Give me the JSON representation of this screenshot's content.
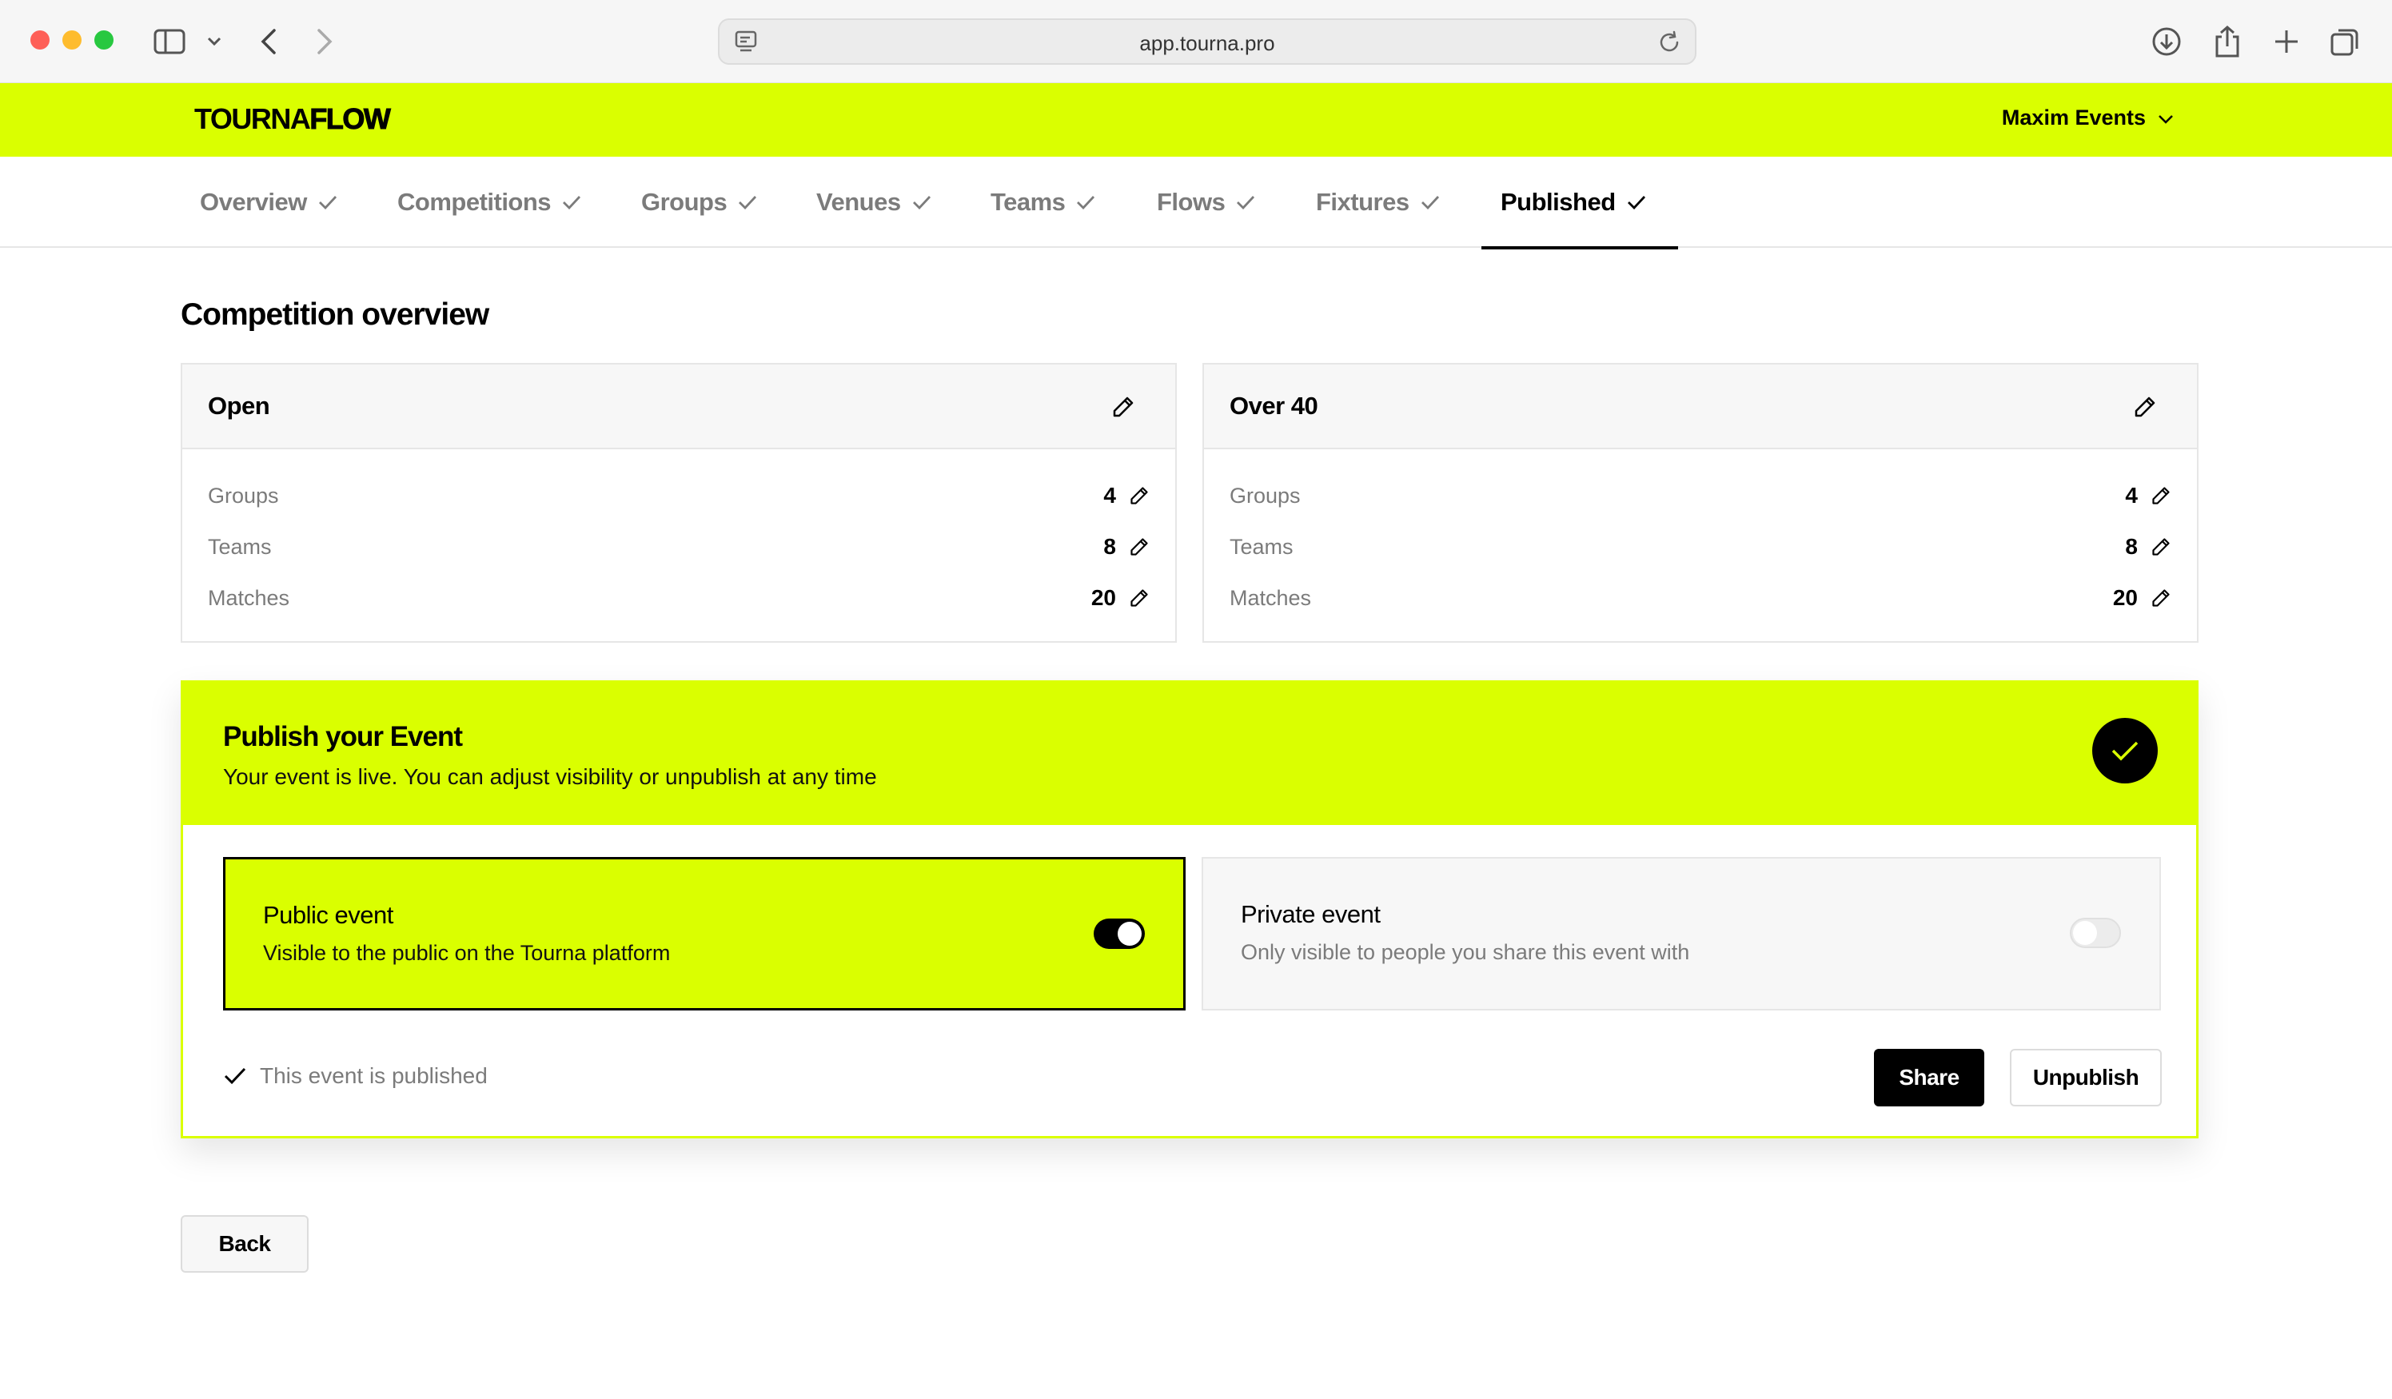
{
  "browser": {
    "url": "app.tourna.pro",
    "icons": [
      "sidebar-icon",
      "chevron-down-icon",
      "back-arrow-icon",
      "forward-arrow-icon",
      "site-settings-icon",
      "reload-icon",
      "download-icon",
      "share-icon",
      "new-tab-icon",
      "tabs-overview-icon"
    ]
  },
  "header": {
    "logo_bold": "TOURNA",
    "logo_light": "FLOW",
    "account_name": "Maxim Events",
    "brand_color": "#daff00"
  },
  "tabs": [
    {
      "label": "Overview",
      "done": true
    },
    {
      "label": "Competitions",
      "done": true
    },
    {
      "label": "Groups",
      "done": true
    },
    {
      "label": "Venues",
      "done": true
    },
    {
      "label": "Teams",
      "done": true
    },
    {
      "label": "Flows",
      "done": true
    },
    {
      "label": "Fixtures",
      "done": true
    },
    {
      "label": "Published",
      "done": true,
      "active": true
    }
  ],
  "main": {
    "title": "Competition overview",
    "competitions": [
      {
        "name": "Open",
        "stats": [
          {
            "label": "Groups",
            "value": "4"
          },
          {
            "label": "Teams",
            "value": "8"
          },
          {
            "label": "Matches",
            "value": "20"
          }
        ]
      },
      {
        "name": "Over 40",
        "stats": [
          {
            "label": "Groups",
            "value": "4"
          },
          {
            "label": "Teams",
            "value": "8"
          },
          {
            "label": "Matches",
            "value": "20"
          }
        ]
      }
    ]
  },
  "publish": {
    "title": "Publish your Event",
    "subtitle": "Your event is live. You can adjust visibility or unpublish at any time",
    "options": {
      "public": {
        "title": "Public event",
        "description": "Visible to the public on the Tourna platform",
        "enabled": true
      },
      "private": {
        "title": "Private event",
        "description": "Only visible to people you share this event with",
        "enabled": false
      }
    },
    "status_text": "This event is published",
    "share_label": "Share",
    "unpublish_label": "Unpublish"
  },
  "footer": {
    "back_label": "Back"
  }
}
